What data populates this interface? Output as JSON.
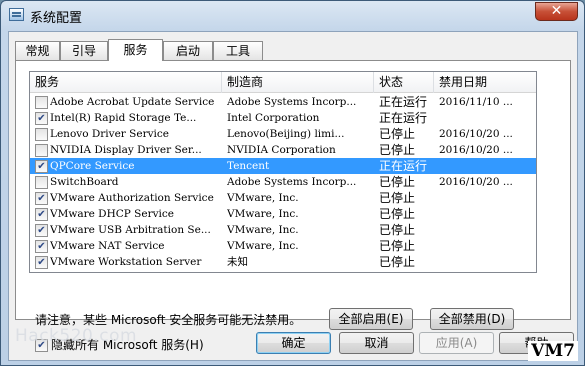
{
  "window": {
    "title": "系统配置",
    "close_label": "✕"
  },
  "tabs": [
    {
      "label": "常规",
      "active": false
    },
    {
      "label": "引导",
      "active": false
    },
    {
      "label": "服务",
      "active": true
    },
    {
      "label": "启动",
      "active": false
    },
    {
      "label": "工具",
      "active": false
    }
  ],
  "services": {
    "columns": [
      "服务",
      "制造商",
      "状态",
      "禁用日期"
    ],
    "rows": [
      {
        "checked": false,
        "service": "Adobe Acrobat Update Service",
        "manufacturer": "Adobe Systems Incorp...",
        "status": "正在运行",
        "date": "2016/11/10 ...",
        "selected": false
      },
      {
        "checked": true,
        "service": "Intel(R) Rapid Storage Te...",
        "manufacturer": "Intel Corporation",
        "status": "正在运行",
        "date": "",
        "selected": false
      },
      {
        "checked": false,
        "service": "Lenovo Driver Service",
        "manufacturer": "Lenovo(Beijing) limi...",
        "status": "已停止",
        "date": "2016/10/20 ...",
        "selected": false
      },
      {
        "checked": false,
        "service": "NVIDIA Display Driver Ser...",
        "manufacturer": "NVIDIA Corporation",
        "status": "已停止",
        "date": "2016/10/20 ...",
        "selected": false
      },
      {
        "checked": true,
        "service": "QPCore Service",
        "manufacturer": "Tencent",
        "status": "正在运行",
        "date": "",
        "selected": true
      },
      {
        "checked": false,
        "service": "SwitchBoard",
        "manufacturer": "Adobe Systems Incorp...",
        "status": "已停止",
        "date": "2016/10/20 ...",
        "selected": false
      },
      {
        "checked": true,
        "service": "VMware Authorization Service",
        "manufacturer": "VMware, Inc.",
        "status": "已停止",
        "date": "",
        "selected": false
      },
      {
        "checked": true,
        "service": "VMware DHCP Service",
        "manufacturer": "VMware, Inc.",
        "status": "已停止",
        "date": "",
        "selected": false
      },
      {
        "checked": true,
        "service": "VMware USB Arbitration Se...",
        "manufacturer": "VMware, Inc.",
        "status": "已停止",
        "date": "",
        "selected": false
      },
      {
        "checked": true,
        "service": "VMware NAT Service",
        "manufacturer": "VMware, Inc.",
        "status": "已停止",
        "date": "",
        "selected": false
      },
      {
        "checked": true,
        "service": "VMware Workstation Server",
        "manufacturer": "未知",
        "status": "已停止",
        "date": "",
        "selected": false
      }
    ]
  },
  "notice": "请注意，某些 Microsoft 安全服务可能无法禁用。",
  "enable_all": "全部启用(E)",
  "disable_all": "全部禁用(D)",
  "hide_ms": {
    "label": "隐藏所有 Microsoft 服务(H)",
    "checked": true
  },
  "buttons": {
    "ok": "确定",
    "cancel": "取消",
    "apply": "应用(A)",
    "help": "帮助"
  },
  "overlays": {
    "watermark": "Hack520.com",
    "badge": "VM7"
  }
}
